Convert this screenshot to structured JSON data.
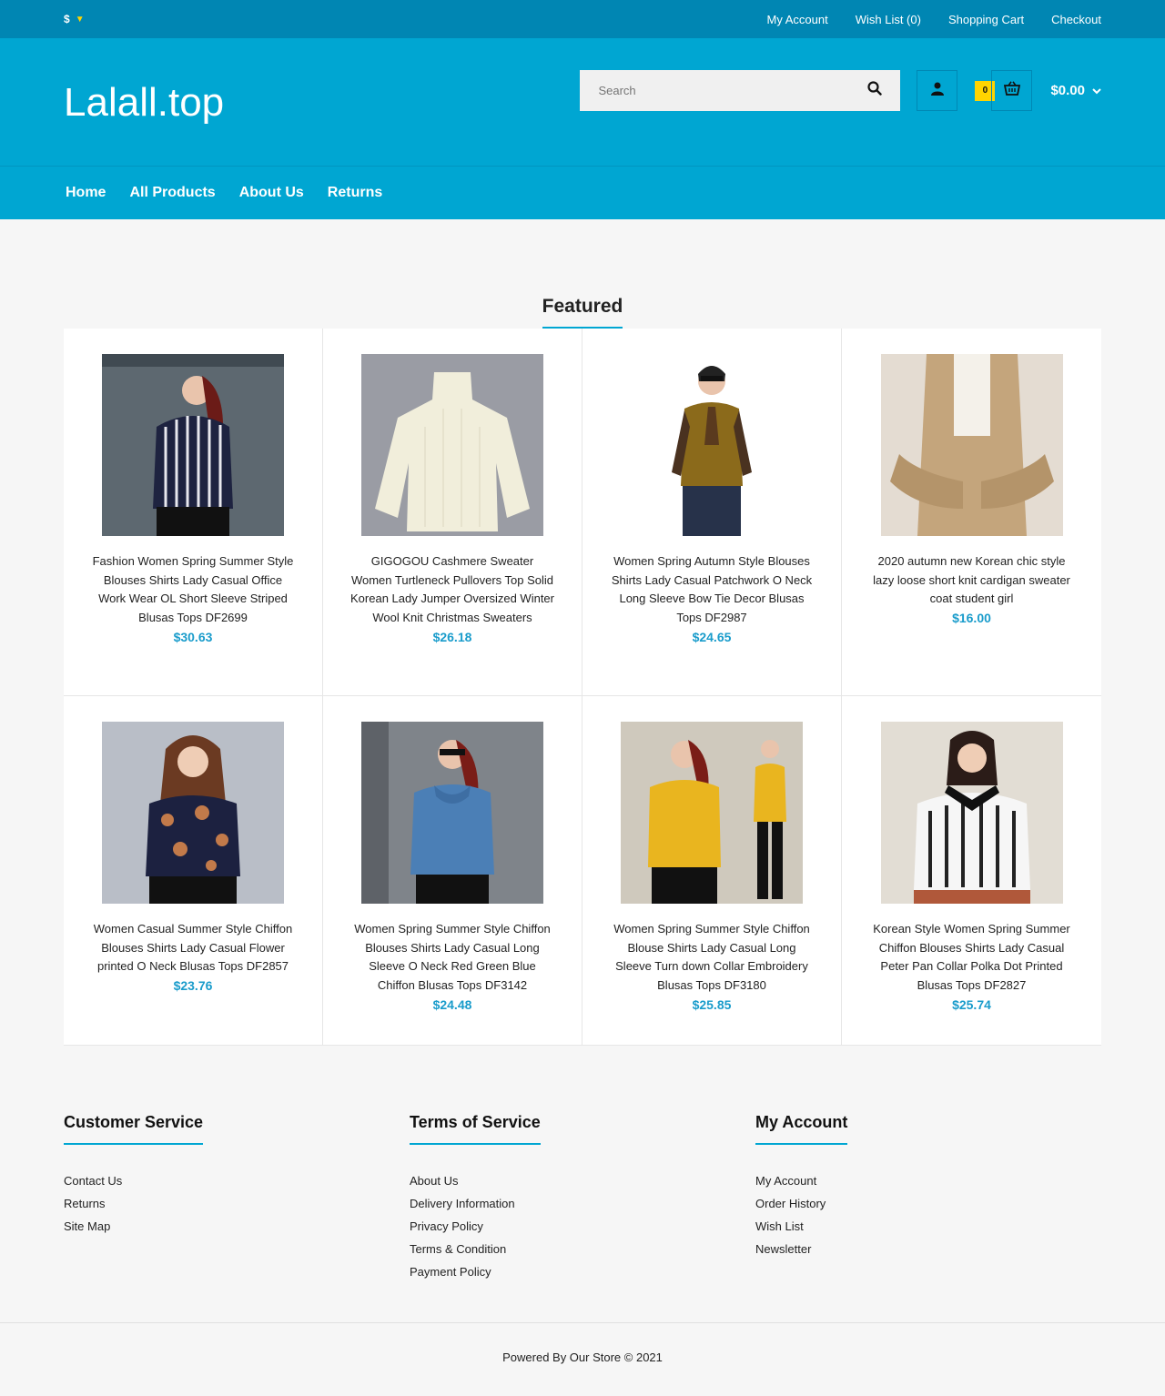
{
  "topbar": {
    "currency": "$",
    "links": [
      "My Account",
      "Wish List (0)",
      "Shopping Cart",
      "Checkout"
    ]
  },
  "header": {
    "logo": "Lalall.top",
    "search_placeholder": "Search",
    "cart_count": "0",
    "cart_total": "$0.00"
  },
  "nav": [
    "Home",
    "All Products",
    "About Us",
    "Returns"
  ],
  "featured": {
    "title": "Featured",
    "products": [
      {
        "name": "Fashion Women Spring Summer Style Blouses Shirts Lady Casual Office Work Wear OL Short Sleeve Striped Blusas Tops DF2699",
        "price": "$30.63"
      },
      {
        "name": "GIGOGOU Cashmere Sweater Women Turtleneck Pullovers Top Solid Korean Lady Jumper Oversized Winter Wool Knit Christmas Sweaters",
        "price": "$26.18"
      },
      {
        "name": "Women Spring Autumn Style Blouses Shirts Lady Casual Patchwork O Neck Long Sleeve Bow Tie Decor Blusas Tops DF2987",
        "price": "$24.65"
      },
      {
        "name": "2020 autumn new Korean chic style lazy loose short knit cardigan sweater coat student girl",
        "price": "$16.00"
      },
      {
        "name": "Women Casual Summer Style Chiffon Blouses Shirts Lady Casual Flower printed O Neck Blusas Tops DF2857",
        "price": "$23.76"
      },
      {
        "name": "Women Spring Summer Style Chiffon Blouses Shirts Lady Casual Long Sleeve O Neck Red Green Blue Chiffon Blusas Tops DF3142",
        "price": "$24.48"
      },
      {
        "name": "Women Spring Summer Style Chiffon Blouse Shirts Lady Casual Long Sleeve Turn down Collar Embroidery Blusas Tops DF3180",
        "price": "$25.85"
      },
      {
        "name": "Korean Style Women Spring Summer Chiffon Blouses Shirts Lady Casual Peter Pan Collar Polka Dot Printed Blusas Tops DF2827",
        "price": "$25.74"
      }
    ]
  },
  "footer": {
    "customer_service": {
      "title": "Customer Service",
      "links": [
        "Contact Us",
        "Returns",
        "Site Map"
      ]
    },
    "terms": {
      "title": "Terms of Service",
      "links": [
        "About Us",
        "Delivery Information",
        "Privacy Policy",
        "Terms & Condition",
        "Payment Policy"
      ]
    },
    "account": {
      "title": "My Account",
      "links": [
        "My Account",
        "Order History",
        "Wish List",
        "Newsletter"
      ]
    },
    "copyright": "Powered By Our Store © 2021"
  }
}
